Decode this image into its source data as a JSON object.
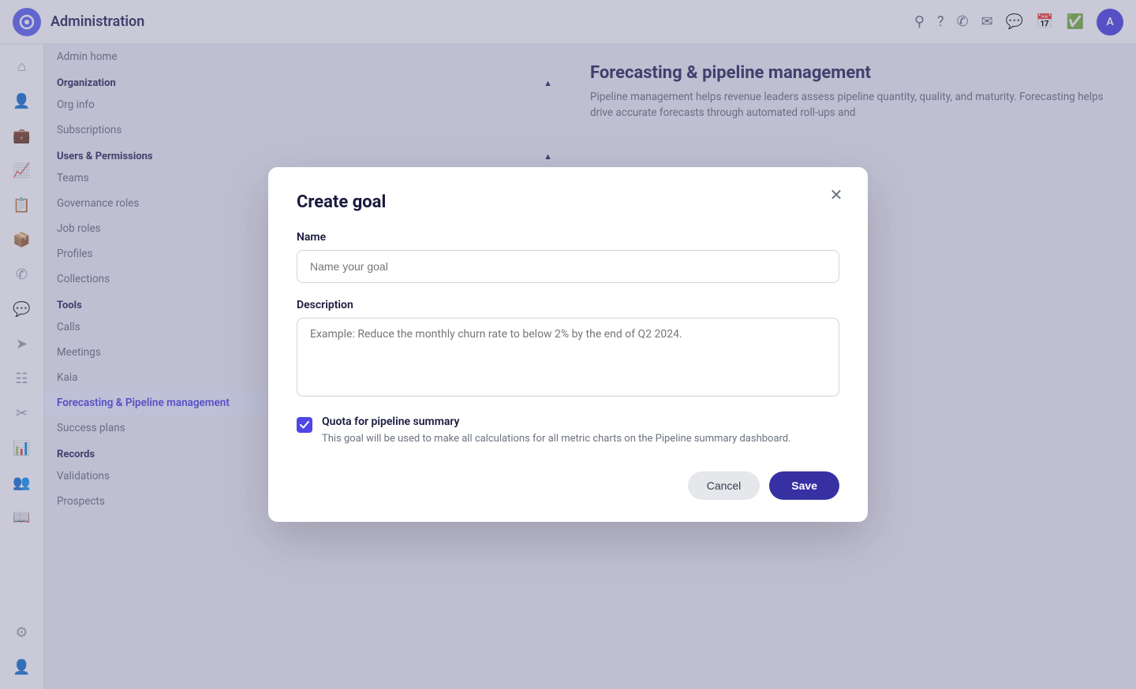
{
  "app": {
    "logo_letter": "○",
    "title": "Administration"
  },
  "topbar": {
    "icons": [
      "search",
      "help",
      "phone",
      "mail",
      "chat",
      "calendar",
      "check"
    ],
    "avatar_letter": "A"
  },
  "sidebar": {
    "top_item": "Admin home",
    "sections": [
      {
        "label": "Organization",
        "expanded": true,
        "items": [
          {
            "label": "Org info",
            "active": false
          },
          {
            "label": "Subscriptions",
            "active": false
          }
        ]
      },
      {
        "label": "Users & Permissions",
        "expanded": true,
        "items": [
          {
            "label": "Teams",
            "active": false
          },
          {
            "label": "Governance roles",
            "active": false
          },
          {
            "label": "Job roles",
            "active": false
          },
          {
            "label": "Profiles",
            "active": false
          },
          {
            "label": "Collections",
            "active": false
          }
        ]
      },
      {
        "label": "Tools",
        "expanded": true,
        "items": [
          {
            "label": "Calls",
            "active": false
          },
          {
            "label": "Meetings",
            "active": false
          },
          {
            "label": "Kaia",
            "active": false
          },
          {
            "label": "Forecasting & Pipeline management",
            "active": true
          },
          {
            "label": "Success plans",
            "active": false
          }
        ]
      },
      {
        "label": "Records",
        "expanded": true,
        "items": [
          {
            "label": "Validations",
            "active": false
          },
          {
            "label": "Prospects",
            "active": false
          }
        ]
      }
    ]
  },
  "main": {
    "title": "Forecasting & pipeline management",
    "description": "Pipeline management helps revenue leaders assess pipeline quantity, quality, and maturity. Forecasting helps drive accurate forecasts through automated roll-ups and"
  },
  "modal": {
    "title": "Create goal",
    "name_label": "Name",
    "name_placeholder": "Name your goal",
    "description_label": "Description",
    "description_placeholder": "Example: Reduce the monthly churn rate to below 2% by the end of Q2 2024.",
    "checkbox_label": "Quota for pipeline summary",
    "checkbox_description": "This goal will be used to make all calculations for all metric charts on the Pipeline summary dashboard.",
    "checkbox_checked": true,
    "cancel_label": "Cancel",
    "save_label": "Save"
  }
}
